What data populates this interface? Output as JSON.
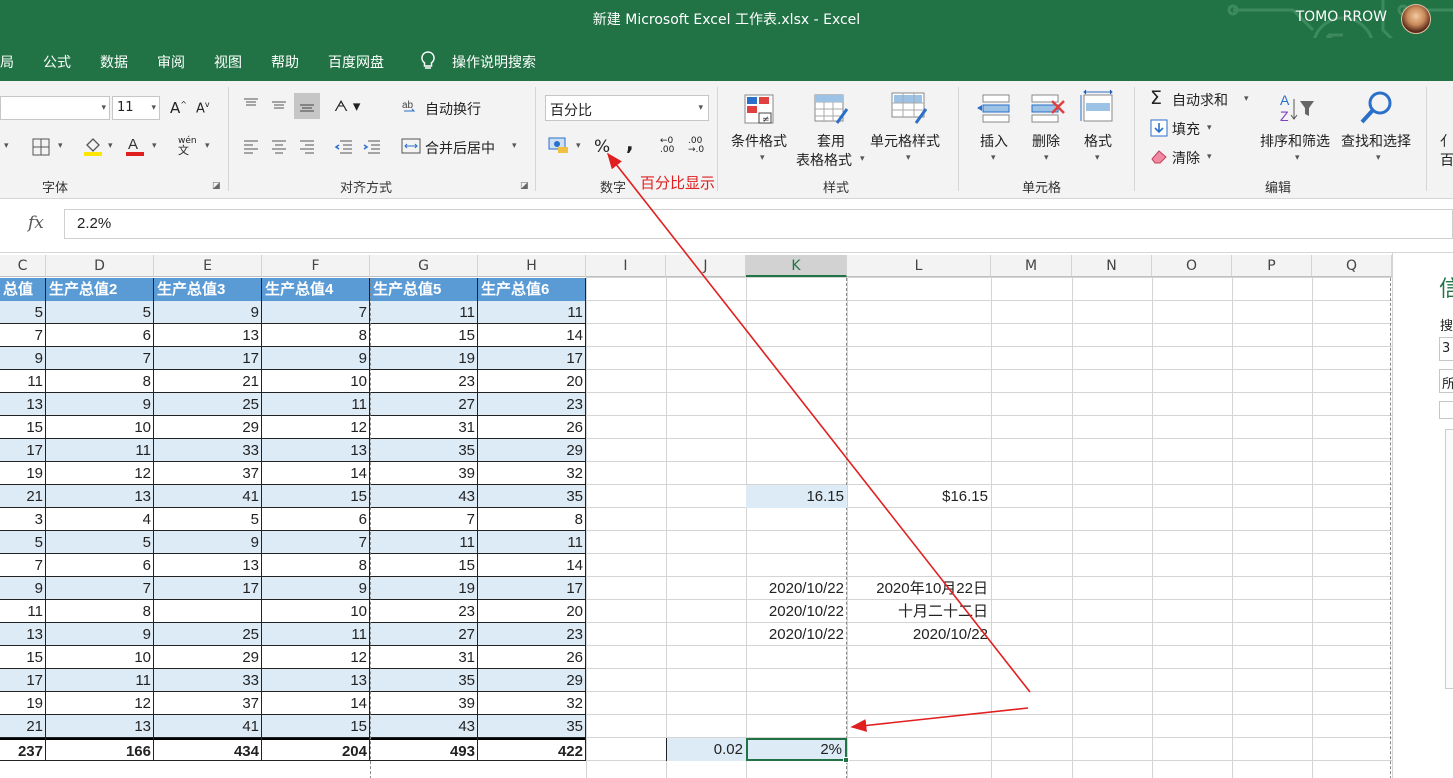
{
  "window": {
    "title": "新建 Microsoft Excel 工作表.xlsx  -  Excel",
    "user": "TOMO RROW"
  },
  "tabs": [
    "局",
    "公式",
    "数据",
    "审阅",
    "视图",
    "帮助",
    "百度网盘",
    "操作说明搜索"
  ],
  "ribbon": {
    "font": {
      "size": "11",
      "label": "字体",
      "underline_label": "文"
    },
    "alignment": {
      "wrap": "自动换行",
      "merge": "合并后居中",
      "label": "对齐方式"
    },
    "number": {
      "format": "百分比",
      "label": "数字",
      "percent_symbol": "%",
      "comma_symbol": ","
    },
    "styles": {
      "conditional": "条件格式",
      "table_line1": "套用",
      "table_line2": "表格格式",
      "cell_styles": "单元格样式",
      "label": "样式"
    },
    "cells": {
      "insert": "插入",
      "delete": "删除",
      "format": "格式",
      "label": "单元格"
    },
    "editing": {
      "autosum": "自动求和",
      "fill": "填充",
      "clear": "清除",
      "sort": "排序和筛选",
      "find": "查找和选择",
      "label": "编辑"
    },
    "partial": {
      "line1": "亻",
      "line2": "百"
    }
  },
  "formula_bar": {
    "fx": "fx",
    "value": "2.2%"
  },
  "columns": [
    "C",
    "D",
    "E",
    "F",
    "G",
    "H",
    "I",
    "J",
    "K",
    "L",
    "M",
    "N",
    "O",
    "P",
    "Q"
  ],
  "selected_column": "K",
  "table": {
    "headers": [
      "总值",
      "生产总值2",
      "生产总值3",
      "生产总值4",
      "生产总值5",
      "生产总值6"
    ],
    "rows": [
      [
        "5",
        "5",
        "9",
        "7",
        "11",
        "11"
      ],
      [
        "7",
        "6",
        "13",
        "8",
        "15",
        "14"
      ],
      [
        "9",
        "7",
        "17",
        "9",
        "19",
        "17"
      ],
      [
        "11",
        "8",
        "21",
        "10",
        "23",
        "20"
      ],
      [
        "13",
        "9",
        "25",
        "11",
        "27",
        "23"
      ],
      [
        "15",
        "10",
        "29",
        "12",
        "31",
        "26"
      ],
      [
        "17",
        "11",
        "33",
        "13",
        "35",
        "29"
      ],
      [
        "19",
        "12",
        "37",
        "14",
        "39",
        "32"
      ],
      [
        "21",
        "13",
        "41",
        "15",
        "43",
        "35"
      ],
      [
        "3",
        "4",
        "5",
        "6",
        "7",
        "8"
      ],
      [
        "5",
        "5",
        "9",
        "7",
        "11",
        "11"
      ],
      [
        "7",
        "6",
        "13",
        "8",
        "15",
        "14"
      ],
      [
        "9",
        "7",
        "17",
        "9",
        "19",
        "17"
      ],
      [
        "11",
        "8",
        "",
        "10",
        "23",
        "20"
      ],
      [
        "13",
        "9",
        "25",
        "11",
        "27",
        "23"
      ],
      [
        "15",
        "10",
        "29",
        "12",
        "31",
        "26"
      ],
      [
        "17",
        "11",
        "33",
        "13",
        "35",
        "29"
      ],
      [
        "19",
        "12",
        "37",
        "14",
        "39",
        "32"
      ],
      [
        "21",
        "13",
        "41",
        "15",
        "43",
        "35"
      ]
    ],
    "totals": [
      "237",
      "166",
      "434",
      "204",
      "493",
      "422"
    ]
  },
  "extra_cells": {
    "k_currency": "16.15",
    "l_currency": "$16.15",
    "k_date1": "2020/10/22",
    "l_date1": "2020年10月22日",
    "k_date2": "2020/10/22",
    "l_date2": "十月二十二日",
    "k_date3": "2020/10/22",
    "l_date3": "2020/10/22",
    "j_decimal": "0.02",
    "k_percent": "2%"
  },
  "annotation": "百分比显示",
  "sidepane": {
    "title": "信",
    "l1": "搜",
    "l2": "3",
    "l3": "所"
  },
  "colors": {
    "excel_green": "#217346",
    "header_blue": "#5b9bd5",
    "band_blue": "#ddebf7",
    "arrow_red": "#e02020"
  }
}
